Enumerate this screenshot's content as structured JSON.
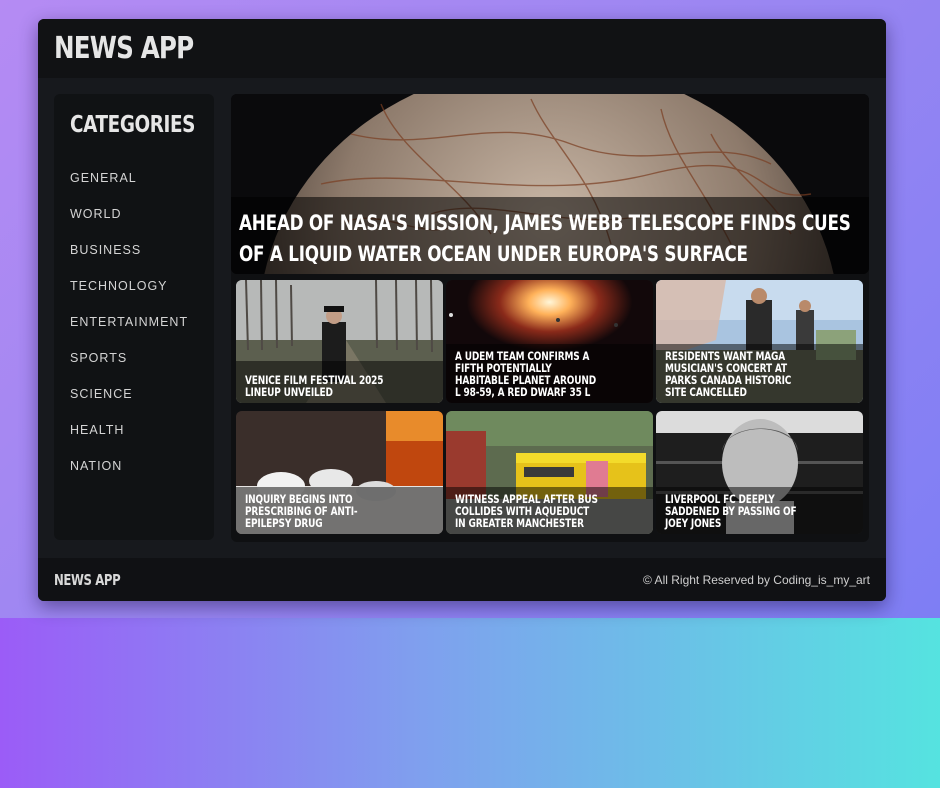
{
  "app": {
    "title": "NEWS APP"
  },
  "sidebar": {
    "heading": "CATEGORIES",
    "items": [
      {
        "label": "GENERAL"
      },
      {
        "label": "WORLD"
      },
      {
        "label": "BUSINESS"
      },
      {
        "label": "TECHNOLOGY"
      },
      {
        "label": "ENTERTAINMENT"
      },
      {
        "label": "SPORTS"
      },
      {
        "label": "SCIENCE"
      },
      {
        "label": "HEALTH"
      },
      {
        "label": "NATION"
      }
    ]
  },
  "hero": {
    "title": "Ahead of NASA's Mission, James Webb Telescope Finds Cues of a Liquid Water Ocean Under Europa's Surface"
  },
  "cards": [
    {
      "title": "Venice Film Festival 2025 lineup unveiled"
    },
    {
      "title": "A UdeM team confirms a fifth potentially habitable planet around L 98-59, a red dwarf 35 l"
    },
    {
      "title": "Residents want MAGA musician's concert at Parks Canada historic site cancelled"
    },
    {
      "title": "Inquiry begins into prescribing of anti-epilepsy drug"
    },
    {
      "title": "Witness appeal after bus collides with aqueduct in Greater Manchester"
    },
    {
      "title": "Liverpool FC deeply saddened by passing of Joey Jones"
    }
  ],
  "footer": {
    "logo": "NEWS APP",
    "copyright": "© All Right Reserved by Coding_is_my_art"
  }
}
